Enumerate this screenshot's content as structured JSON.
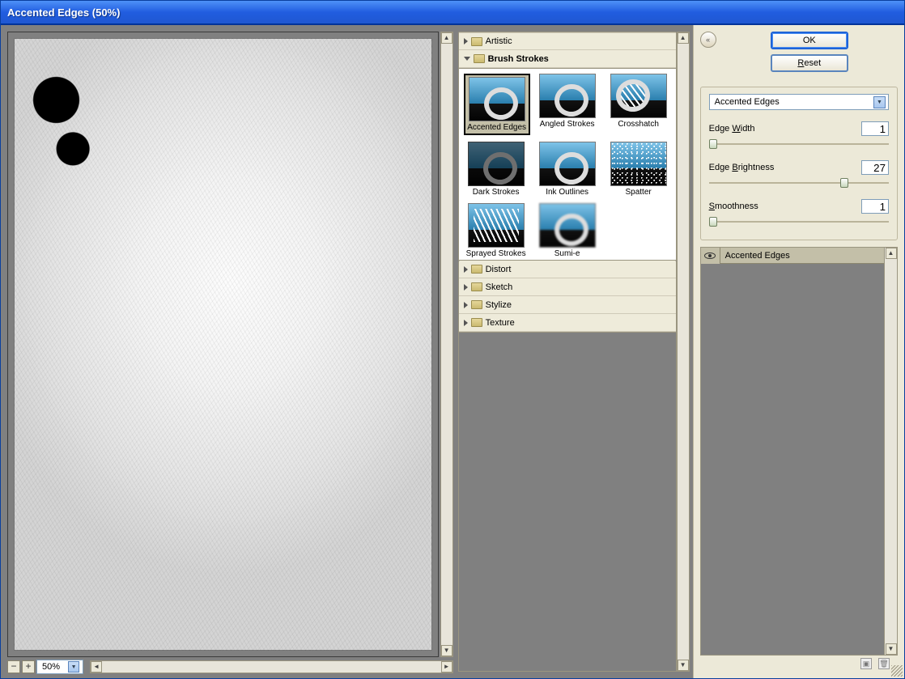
{
  "title": "Accented Edges (50%)",
  "zoom": {
    "minus": "−",
    "plus": "+",
    "percent": "50%"
  },
  "filter_tree": {
    "categories": [
      {
        "label": "Artistic",
        "expanded": false
      },
      {
        "label": "Brush Strokes",
        "expanded": true
      },
      {
        "label": "Distort",
        "expanded": false
      },
      {
        "label": "Sketch",
        "expanded": false
      },
      {
        "label": "Stylize",
        "expanded": false
      },
      {
        "label": "Texture",
        "expanded": false
      }
    ],
    "brush_strokes": [
      {
        "label": "Accented Edges",
        "selected": true
      },
      {
        "label": "Angled Strokes",
        "selected": false
      },
      {
        "label": "Crosshatch",
        "selected": false
      },
      {
        "label": "Dark Strokes",
        "selected": false
      },
      {
        "label": "Ink Outlines",
        "selected": false
      },
      {
        "label": "Spatter",
        "selected": false
      },
      {
        "label": "Sprayed Strokes",
        "selected": false
      },
      {
        "label": "Sumi-e",
        "selected": false
      }
    ]
  },
  "buttons": {
    "ok": "OK",
    "reset": "Reset"
  },
  "effect": {
    "name": "Accented Edges",
    "params": [
      {
        "label": "Edge Width",
        "value": "1",
        "pos": 0
      },
      {
        "label": "Edge Brightness",
        "value": "27",
        "pos": 73
      },
      {
        "label": "Smoothness",
        "value": "1",
        "pos": 0
      }
    ]
  },
  "stack": {
    "item": "Accented Edges"
  }
}
